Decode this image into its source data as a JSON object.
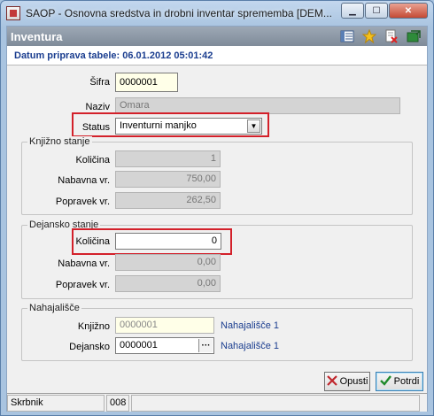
{
  "window": {
    "title": "SAOP -  Osnovna sredstva in drobni inventar sprememba [DEM...",
    "minimize_glyph": "▁",
    "maximize_glyph": "☐",
    "close_glyph": "✕"
  },
  "header": {
    "title": "Inventura",
    "toolbar_icons": [
      "list-icon",
      "star-icon",
      "delete-doc-icon",
      "export-icon"
    ]
  },
  "date_label": "Datum priprava tabele: 06.01.2012 05:01:42",
  "fields": {
    "sifra_label": "Šifra",
    "sifra_value": "0000001",
    "naziv_label": "Naziv",
    "naziv_value": "Omara",
    "status_label": "Status",
    "status_value": "Inventurni manjko"
  },
  "knjizno_stanje": {
    "title": "Knjižno stanje",
    "kolicina_label": "Količina",
    "kolicina_value": "1",
    "nabavna_label": "Nabavna vr.",
    "nabavna_value": "750,00",
    "popravek_label": "Popravek vr.",
    "popravek_value": "262,50"
  },
  "dejansko_stanje": {
    "title": "Dejansko stanje",
    "kolicina_label": "Količina",
    "kolicina_value": "0",
    "nabavna_label": "Nabavna vr.",
    "nabavna_value": "0,00",
    "popravek_label": "Popravek vr.",
    "popravek_value": "0,00"
  },
  "nahajalisce": {
    "title": "Nahajališče",
    "knjizno_label": "Knjižno",
    "knjizno_value": "0000001",
    "knjizno_name": "Nahajališče 1",
    "dejansko_label": "Dejansko",
    "dejansko_value": "0000001",
    "dejansko_name": "Nahajališče 1",
    "lookup_glyph": "···"
  },
  "buttons": {
    "cancel_label": "Opusti",
    "confirm_label": "Potrdi"
  },
  "status_bar": {
    "user": "Skrbnik",
    "code": "008"
  },
  "colors": {
    "highlight_box": "#d3202a",
    "header_bg": "#8f9aa8",
    "link_blue": "#1a3d8f"
  }
}
